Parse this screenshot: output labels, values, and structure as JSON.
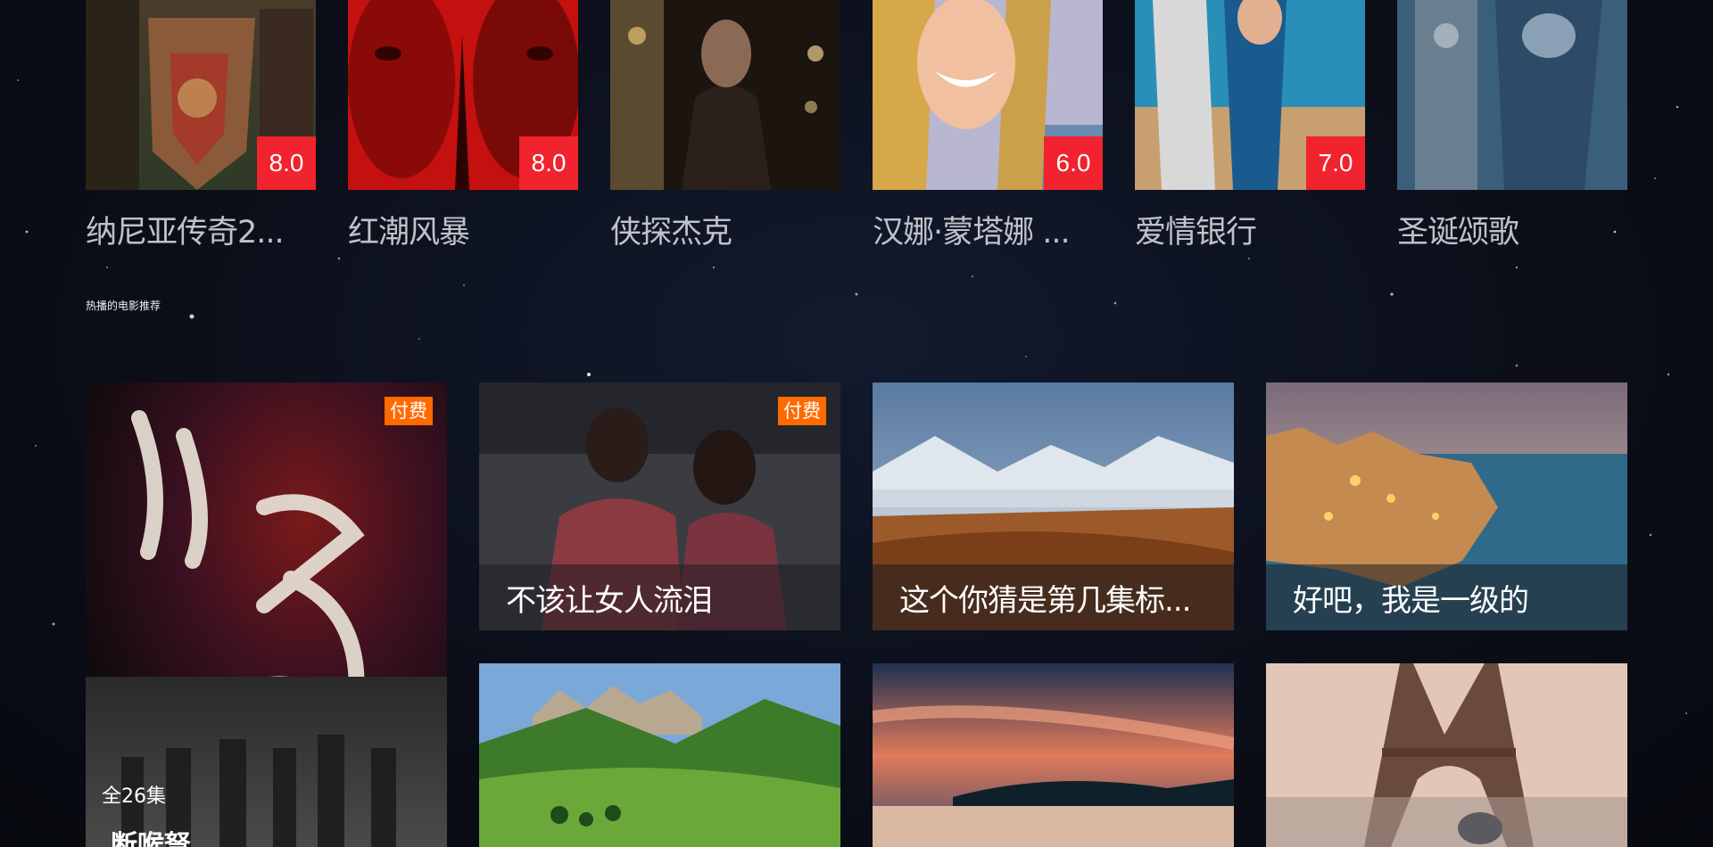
{
  "top_row": [
    {
      "title": "纳尼亚传奇2...",
      "rating": "8.0"
    },
    {
      "title": "红潮风暴",
      "rating": "8.0"
    },
    {
      "title": "侠探杰克",
      "rating": ""
    },
    {
      "title": "汉娜·蒙塔娜 ...",
      "rating": "6.0"
    },
    {
      "title": "爱情银行",
      "rating": "7.0"
    },
    {
      "title": "圣诞颂歌",
      "rating": ""
    }
  ],
  "section": {
    "title": "热播的电影推荐"
  },
  "featured": {
    "tag": "付费",
    "episodes": "全26集",
    "title": "断喉弩"
  },
  "grid": [
    {
      "caption": "不该让女人流泪",
      "tag": "付费"
    },
    {
      "caption": "这个你猜是第几集标...",
      "tag": ""
    },
    {
      "caption": "好吧，我是一级的",
      "tag": ""
    },
    {
      "caption": "",
      "tag": ""
    },
    {
      "caption": "",
      "tag": ""
    },
    {
      "caption": "",
      "tag": ""
    }
  ],
  "colors": {
    "rating_badge": "#f0232e",
    "paid_tag": "#ff6a00",
    "background": "#0b0e18"
  }
}
